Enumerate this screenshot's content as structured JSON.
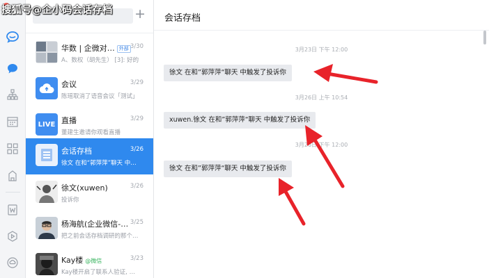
{
  "watermark": "搜狐号@企小码会话存档",
  "list": {
    "items": [
      {
        "name": "华数 | 企微对…",
        "tag": "外部",
        "time": "3/30",
        "preview": "A、数权（胡先生）  [3]: 好的",
        "avatar": "group"
      },
      {
        "name": "会议",
        "time": "3/29",
        "preview": "陈瑶取消了语音会议「测试」",
        "avatar": "cloud"
      },
      {
        "name": "直播",
        "time": "3/29",
        "preview": "董建生邀请你观看直播",
        "avatar": "live",
        "avatar_text": "LIVE"
      },
      {
        "name": "会话存档",
        "time": "3/26",
        "preview": "徐文 在和“郭萍萍”聊天 中…",
        "avatar": "archive"
      },
      {
        "name": "徐文(xuwen)",
        "time": "3/26",
        "preview": "投诉你",
        "avatar": "photo"
      },
      {
        "name": "杨海航(企业微信-…",
        "time": "3/25",
        "preview": "把之前会话存档调研的那个…",
        "avatar": "person"
      },
      {
        "name": "Kay楼",
        "tag": "@微信",
        "time": "3/23",
        "preview": "Kay楼开启了联系人验证, …",
        "avatar": "photo2"
      }
    ]
  },
  "chat": {
    "title": "会话存档",
    "timestamps": [
      "3月23日 下午 12:00",
      "3月26日 上午 10:54",
      "3月26日 下午 12:00"
    ],
    "messages": [
      "徐文 在和”郭萍萍“聊天 中触发了投诉你",
      "xuwen.徐文 在和”郭萍萍“聊天 中触发了投诉你",
      "徐文 在和”郭萍萍“聊天 中触发了投诉你"
    ]
  },
  "colors": {
    "accent": "#2f89ee",
    "arrow": "#e8232a",
    "bubble": "#e8eaee"
  }
}
